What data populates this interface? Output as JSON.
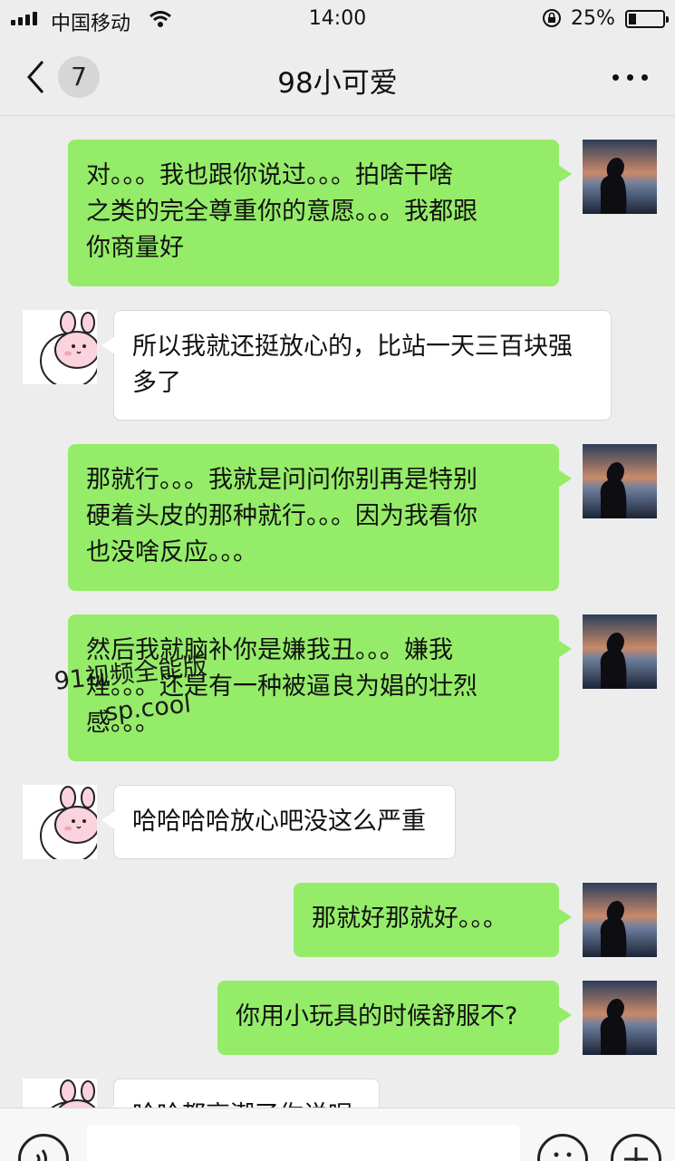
{
  "status_bar": {
    "carrier": "中国移动",
    "time": "14:00",
    "battery_percent_text": "25%",
    "battery_level": 0.25
  },
  "nav": {
    "unread_count": "7",
    "title": "98小可爱",
    "back_icon": "chevron-left-icon",
    "more_icon": "more-dots-icon"
  },
  "messages": [
    {
      "from": "me",
      "text": "对。。。我也跟你说过。。。拍啥干啥\n之类的完全尊重你的意愿。。。我都跟\n你商量好"
    },
    {
      "from": "other",
      "text": "所以我就还挺放心的，比站一天三百块强\n多了"
    },
    {
      "from": "me",
      "text": "那就行。。。我就是问问你别再是特别\n硬着头皮的那种就行。。。因为我看你\n也没啥反应。。。"
    },
    {
      "from": "me",
      "text": "然后我就脑补你是嫌我丑。。。嫌我\n矬。。。还是有一种被逼良为娼的壮烈\n感。。。"
    },
    {
      "from": "other",
      "text": "哈哈哈哈放心吧没这么严重"
    },
    {
      "from": "me",
      "text": "那就好那就好。。。"
    },
    {
      "from": "me",
      "text": "你用小玩具的时候舒服不?"
    },
    {
      "from": "other",
      "text": "哈哈都高潮了你说呢"
    }
  ],
  "watermark": {
    "line1": "91视频全能版",
    "line2": "sp.cool"
  },
  "input_bar": {
    "voice_icon": "voice-icon",
    "emoji_icon": "emoji-icon",
    "plus_icon": "plus-icon"
  },
  "colors": {
    "my_bubble": "#95ec69",
    "other_bubble": "#ffffff",
    "background": "#ededed"
  }
}
